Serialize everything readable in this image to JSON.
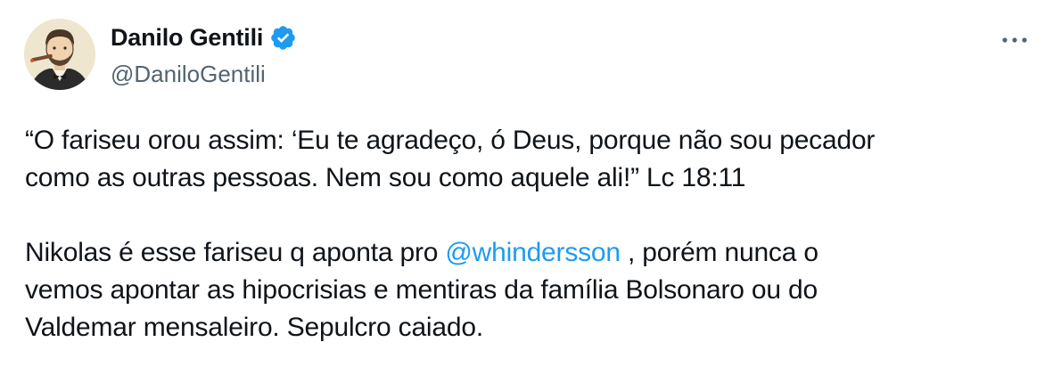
{
  "author": {
    "display_name": "Danilo Gentili",
    "handle": "@DaniloGentili",
    "verified": true
  },
  "colors": {
    "text": "#0f1419",
    "secondary": "#536471",
    "accent": "#1d9bf0"
  },
  "icons": {
    "more": "more-options-icon",
    "verified": "verified-badge-icon"
  },
  "tweet": {
    "p1_line1": "“O fariseu orou assim: ‘Eu te agradeço, ó Deus, porque não sou pecador",
    "p1_line2": "como as outras pessoas. Nem sou como aquele ali!” Lc 18:11",
    "p2_line1_pre": "Nikolas é esse fariseu q aponta pro ",
    "mention": "@whindersson",
    "p2_line1_post": " , porém nunca o",
    "p2_line2": "vemos apontar as hipocrisias e mentiras da família Bolsonaro ou do",
    "p2_line3": "Valdemar mensaleiro. Sepulcro caiado."
  }
}
